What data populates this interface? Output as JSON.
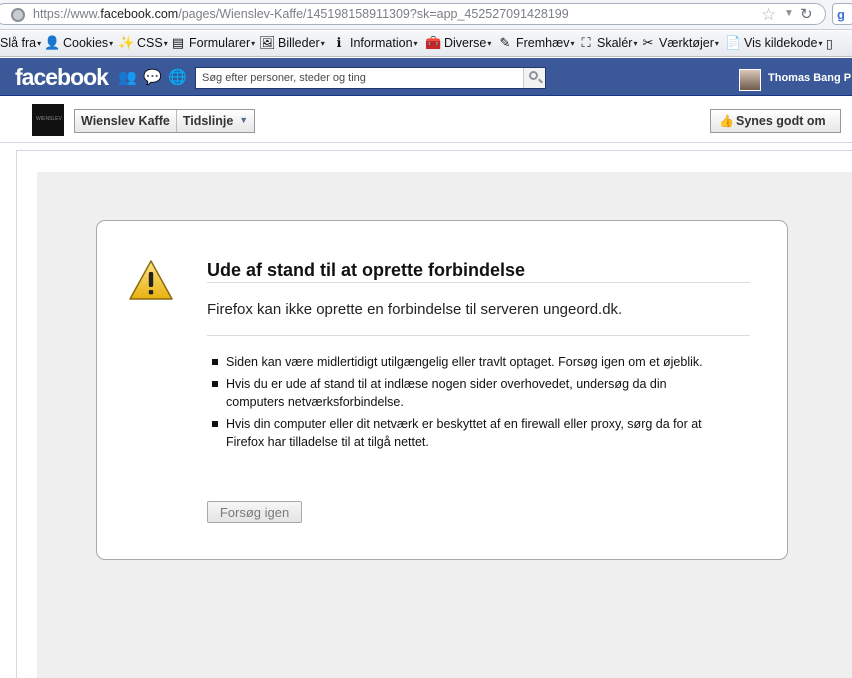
{
  "browser": {
    "url_prefix": "https://www.",
    "url_domain": "facebook.com",
    "url_path": "/pages/Wienslev-Kaffe/145198158911309?sk=app_452527091428199",
    "toolbar": [
      {
        "label": "Slå fra",
        "icon": "disable-icon"
      },
      {
        "label": "Cookies",
        "icon": "cookie-icon"
      },
      {
        "label": "CSS",
        "icon": "wand-icon"
      },
      {
        "label": "Formularer",
        "icon": "form-icon"
      },
      {
        "label": "Billeder",
        "icon": "image-icon"
      },
      {
        "label": "Information",
        "icon": "info-icon"
      },
      {
        "label": "Diverse",
        "icon": "misc-icon"
      },
      {
        "label": "Fremhæv",
        "icon": "highlight-icon"
      },
      {
        "label": "Skalér",
        "icon": "resize-icon"
      },
      {
        "label": "Værktøjer",
        "icon": "tools-icon"
      },
      {
        "label": "Vis kildekode",
        "icon": "source-icon"
      }
    ]
  },
  "facebook": {
    "logo": "facebook",
    "search_placeholder": "Søg efter personer, steder og ting",
    "user_name": "Thomas Bang P",
    "page_name": "Wienslev Kaffe",
    "page_thumb_text": "WIENSLEV",
    "timeline_label": "Tidslinje",
    "like_label": "Synes godt om"
  },
  "error": {
    "title": "Ude af stand til at oprette forbindelse",
    "description": "Firefox kan ikke oprette en forbindelse til serveren ungeord.dk.",
    "items": [
      "Siden kan være midlertidigt utilgængelig eller travlt optaget. Forsøg igen om et øjeblik.",
      "Hvis du er ude af stand til at indlæse nogen sider overhovedet, undersøg da din computers netværksforbindelse.",
      "Hvis din computer eller dit netværk er beskyttet af en firewall eller proxy, sørg da for at Firefox har tilladelse til at tilgå nettet."
    ],
    "retry_label": "Forsøg igen"
  },
  "colors": {
    "fb_blue": "#3b5998",
    "warning_yellow": "#f3c623"
  }
}
